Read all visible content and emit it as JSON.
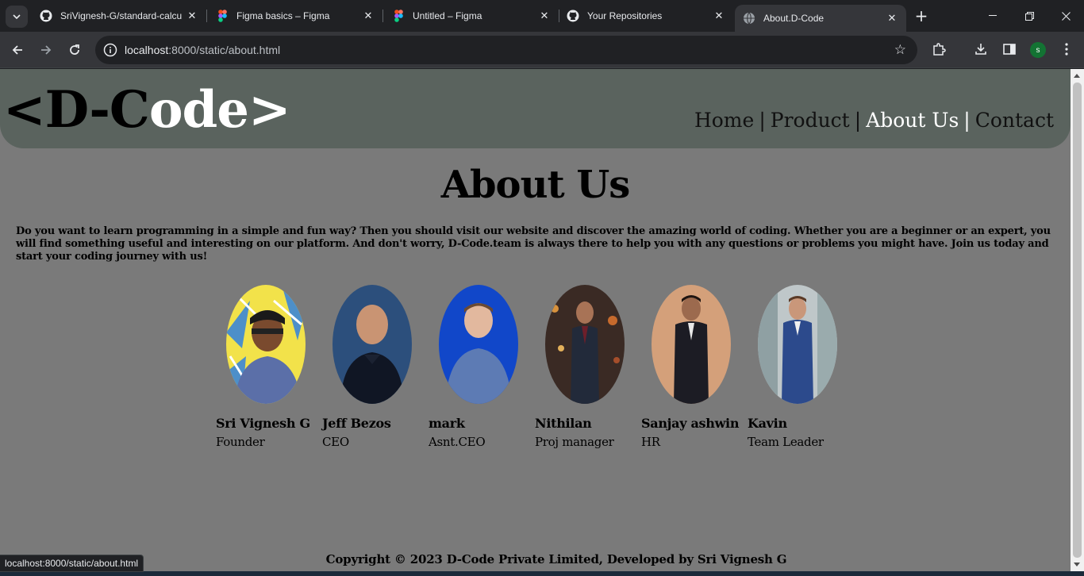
{
  "browser": {
    "tabs": [
      {
        "title": "SriVignesh-G/standard-calcu",
        "icon": "github-icon",
        "active": false
      },
      {
        "title": "Figma basics – Figma",
        "icon": "figma-icon",
        "active": false
      },
      {
        "title": "Untitled – Figma",
        "icon": "figma-icon",
        "active": false
      },
      {
        "title": "Your Repositories",
        "icon": "github-icon",
        "active": false
      },
      {
        "title": "About.D-Code",
        "icon": "globe-icon",
        "active": true
      }
    ],
    "url_host": "localhost",
    "url_path": ":8000/static/about.html",
    "profile_initial": "s",
    "status_url": "localhost:8000/static/about.html"
  },
  "site": {
    "logo_lt": "<",
    "logo_dark": "D-C",
    "logo_light": "ode",
    "logo_gt": ">",
    "nav": [
      {
        "label": "Home",
        "active": false
      },
      {
        "label": "Product",
        "active": false
      },
      {
        "label": "About Us",
        "active": true
      },
      {
        "label": "Contact",
        "active": false
      }
    ],
    "nav_separator": "|",
    "title": "About Us",
    "intro": "Do you want to learn programming in a simple and fun way? Then you should visit our website and discover the amazing world of coding. Whether you are a beginner or an expert, you will find something useful and interesting on our platform. And don't worry, D-Code.team is always there to help you with any questions or problems you might have. Join us today and start your coding journey with us!",
    "team": [
      {
        "name": "Sri Vignesh G",
        "role": "Founder"
      },
      {
        "name": "Jeff Bezos",
        "role": "CEO"
      },
      {
        "name": "mark",
        "role": "Asnt.CEO"
      },
      {
        "name": "Nithilan",
        "role": "Proj manager"
      },
      {
        "name": "Sanjay ashwin",
        "role": "HR"
      },
      {
        "name": "Kavin",
        "role": "Team Leader"
      }
    ],
    "copyright": "Copyright © 2023 D-Code Private Limited, Developed by Sri Vignesh G"
  },
  "colors": {
    "page_bg": "#7a7a7a",
    "header_bg": "#5a635e",
    "nav_active": "#ffffff"
  }
}
